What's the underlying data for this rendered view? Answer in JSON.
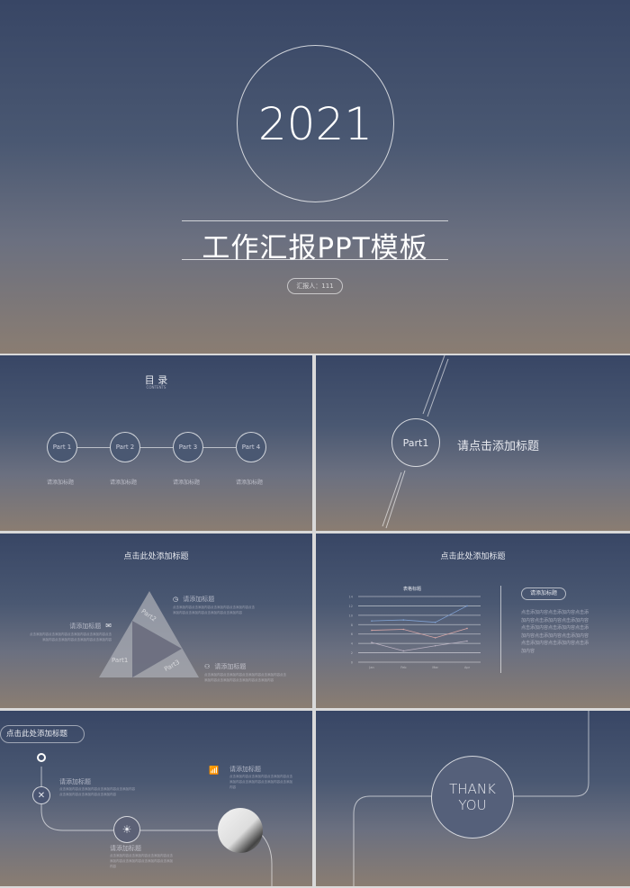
{
  "slide1": {
    "year": "2021",
    "title": "工作汇报PPT模板",
    "reporter": "汇报人：111"
  },
  "slide2": {
    "title": "目 录",
    "subtitle": "CONTENTS",
    "parts": [
      {
        "label": "Part 1",
        "caption": "请添加标题"
      },
      {
        "label": "Part 2",
        "caption": "请添加标题"
      },
      {
        "label": "Part 3",
        "caption": "请添加标题"
      },
      {
        "label": "Part 4",
        "caption": "请添加标题"
      }
    ]
  },
  "slide3": {
    "part": "Part1",
    "title": "请点击添加标题"
  },
  "slide4": {
    "title": "点击此处添加标题",
    "triangle": [
      "Part1",
      "Part2",
      "Part3"
    ],
    "items": [
      {
        "heading": "请添加标题",
        "icon": "mail-icon",
        "text": "点击添加内容点击添加内容点击添加内容点击添加内容点击添加内容点击添加内容点击添加内容点击添加内容"
      },
      {
        "heading": "请添加标题",
        "icon": "clock-icon",
        "text": "点击添加内容点击添加内容点击添加内容点击添加内容点击添加内容点击添加内容点击添加内容点击添加内容"
      },
      {
        "heading": "请添加标题",
        "icon": "people-icon",
        "text": "点击添加内容点击添加内容点击添加内容点击添加内容点击添加内容点击添加内容点击添加内容点击添加内容"
      }
    ]
  },
  "slide5": {
    "title": "点击此处添加标题",
    "side_heading": "请添加标题",
    "side_text": "点击添加内容点击添加内容点击添加内容点击添加内容点击添加内容点击添加内容点击添加内容点击添加内容点击添加内容点击添加内容点击添加内容点击添加内容点击添加内容"
  },
  "chart_data": {
    "type": "line",
    "title": "表格标题",
    "categories": [
      "Jan",
      "Feb",
      "Mar",
      "Apr"
    ],
    "ylim": [
      0,
      14
    ],
    "yticks": [
      0,
      2,
      4,
      6,
      8,
      10,
      12,
      14
    ],
    "grid": true,
    "series": [
      {
        "values": [
          8.8,
          9,
          8.5,
          12
        ],
        "color": "#7f9fd0"
      },
      {
        "values": [
          6.8,
          7,
          5.2,
          7.2
        ],
        "color": "#d4a5a5"
      },
      {
        "values": [
          4.2,
          2.4,
          3.5,
          4.5
        ],
        "color": "#b8b0c0"
      }
    ]
  },
  "slide6": {
    "title": "点击此处添加标题",
    "items": [
      {
        "heading": "请添加标题",
        "icon": "tools-icon",
        "text": "点击添加内容点击添加内容点击添加内容点击添加内容点击添加内容点击添加内容点击添加内容"
      },
      {
        "heading": "请添加标题",
        "icon": "lightbulb-icon",
        "text": "点击添加内容点击添加内容点击添加内容点击添加内容点击添加内容点击添加内容点击添加内容"
      },
      {
        "heading": "请添加标题",
        "icon": "bar-chart-icon",
        "text": "点击添加内容点击添加内容点击添加内容点击添加内容点击添加内容点击添加内容点击添加内容"
      }
    ]
  },
  "slide7": {
    "line1": "THANK",
    "line2": "YOU"
  }
}
